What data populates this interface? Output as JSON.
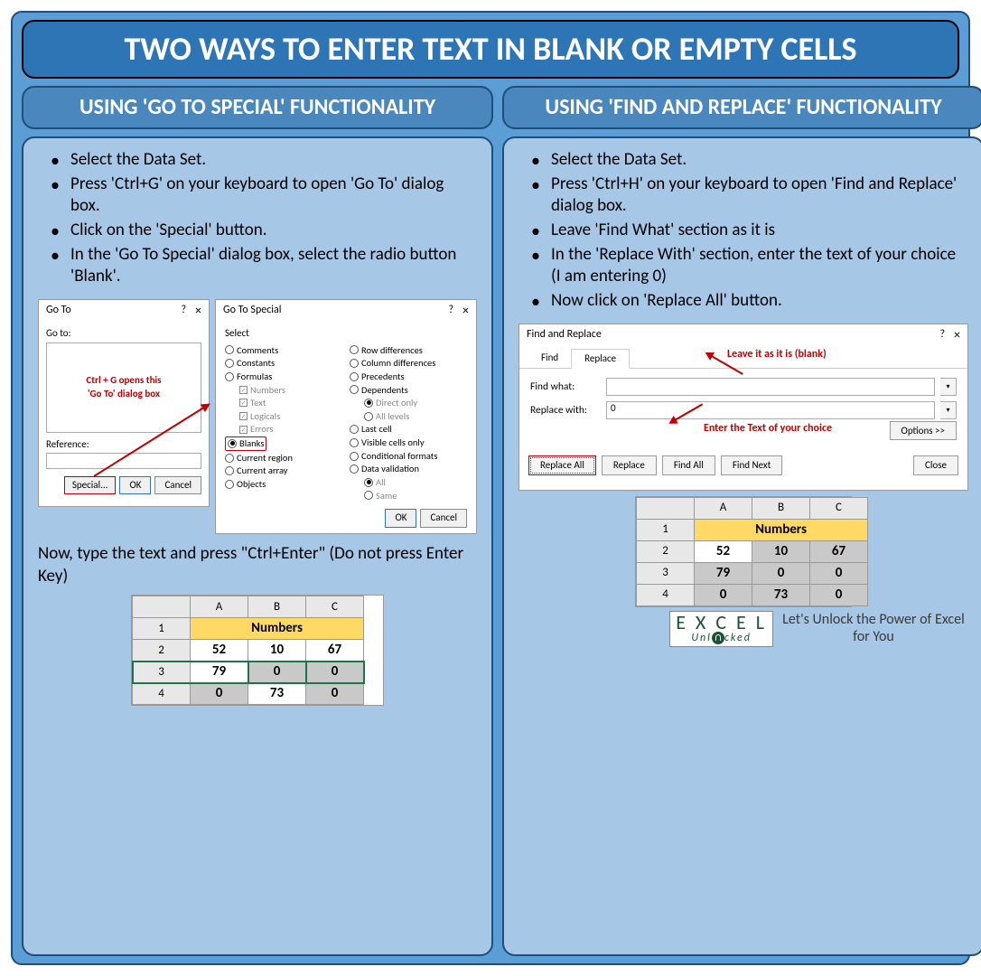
{
  "title": "TWO WAYS TO ENTER TEXT IN BLANK OR EMPTY CELLS",
  "left": {
    "heading": "USING 'GO TO SPECIAL' FUNCTIONALITY",
    "bullets": [
      "Select the Data Set.",
      "Press 'Ctrl+G' on your keyboard to open 'Go To' dialog box.",
      "Click on the 'Special' button.",
      "In the 'Go To Special' dialog box, select the radio button 'Blank'."
    ],
    "goto_title": "Go To",
    "goto_label": "Go to:",
    "goto_hint1": "Ctrl + G opens this",
    "goto_hint2": "'Go To' dialog box",
    "ref_label": "Reference:",
    "special_btn": "Special...",
    "ok": "OK",
    "cancel": "Cancel",
    "gts_title": "Go To Special",
    "gts_select": "Select",
    "gts_left": [
      "Comments",
      "Constants",
      "Formulas",
      "Numbers",
      "Text",
      "Logicals",
      "Errors",
      "Blanks",
      "Current region",
      "Current array",
      "Objects"
    ],
    "gts_right": [
      "Row differences",
      "Column differences",
      "Precedents",
      "Dependents",
      "Direct only",
      "All levels",
      "Last cell",
      "Visible cells only",
      "Conditional formats",
      "Data validation",
      "All",
      "Same"
    ],
    "after_text": "Now, type the text and press \"Ctrl+Enter\" (Do not press Enter Key)",
    "sheet": {
      "cols": [
        "A",
        "B",
        "C"
      ],
      "header": "Numbers",
      "rows": [
        [
          "52",
          "10",
          "67"
        ],
        [
          "79",
          "0",
          "0"
        ],
        [
          "0",
          "73",
          "0"
        ]
      ]
    }
  },
  "right": {
    "heading": "USING 'FIND AND REPLACE' FUNCTIONALITY",
    "bullets": [
      "Select the Data Set.",
      "Press 'Ctrl+H' on your keyboard to open 'Find and Replace' dialog box.",
      "Leave 'Find What' section as it is",
      "In the 'Replace With' section, enter the text of your choice (I am entering 0)",
      "Now click on 'Replace All' button."
    ],
    "fr_title": "Find and Replace",
    "tab_find": "Find",
    "tab_replace": "Replace",
    "find_what_label": "Find what:",
    "replace_with_label": "Replace with:",
    "replace_with_value": "0",
    "note_find": "Leave it as it is (blank)",
    "note_replace": "Enter the Text of your choice",
    "options_btn": "Options >>",
    "btn_replace_all": "Replace All",
    "btn_replace": "Replace",
    "btn_find_all": "Find All",
    "btn_find_next": "Find Next",
    "btn_close": "Close",
    "sheet": {
      "cols": [
        "A",
        "B",
        "C"
      ],
      "header": "Numbers",
      "rows": [
        [
          "52",
          "10",
          "67"
        ],
        [
          "79",
          "0",
          "0"
        ],
        [
          "0",
          "73",
          "0"
        ]
      ]
    }
  },
  "footer": {
    "logo_top": "E X C E L",
    "logo_bottom": "Unlocked",
    "tagline": "Let's Unlock the Power of Excel for You"
  }
}
